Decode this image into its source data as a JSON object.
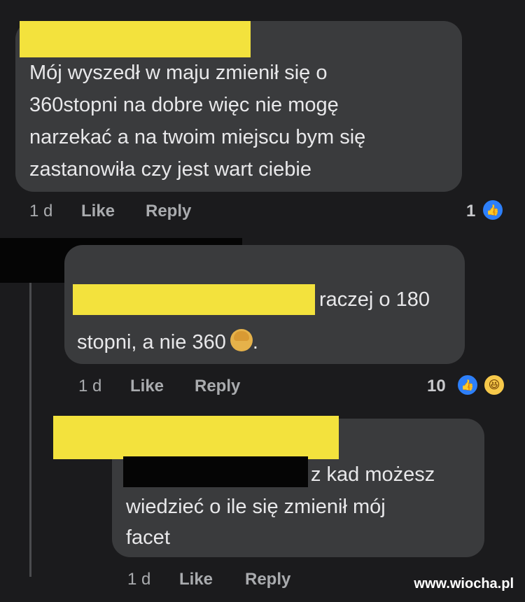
{
  "comments": [
    {
      "lines": [
        "Mój wyszedł w maju zmienił się o",
        "360stopni na dobre więc nie mogę",
        "narzekać a na twoim miejscu bym się",
        "zastanowiła czy  jest wart ciebie"
      ],
      "time": "1 d",
      "like_label": "Like",
      "reply_label": "Reply",
      "reaction_count": "1",
      "reactions": [
        "like-icon"
      ]
    },
    {
      "lines": [
        "raczej o 180",
        "stopni, a nie 360",
        "."
      ],
      "time": "1 d",
      "like_label": "Like",
      "reply_label": "Reply",
      "reaction_count": "10",
      "reactions": [
        "like-icon",
        "haha-icon"
      ]
    },
    {
      "lines": [
        "z kad możesz",
        "wiedzieć o ile się zmienił mój",
        "facet"
      ],
      "time": "1 d",
      "like_label": "Like",
      "reply_label": "Reply"
    }
  ],
  "watermark": "www.wiocha.pl",
  "colors": {
    "background": "#1b1b1d",
    "bubble": "#3a3b3d",
    "redaction_yellow": "#f3e23d",
    "redaction_black": "#050505",
    "like_blue": "#2d7ff9"
  }
}
